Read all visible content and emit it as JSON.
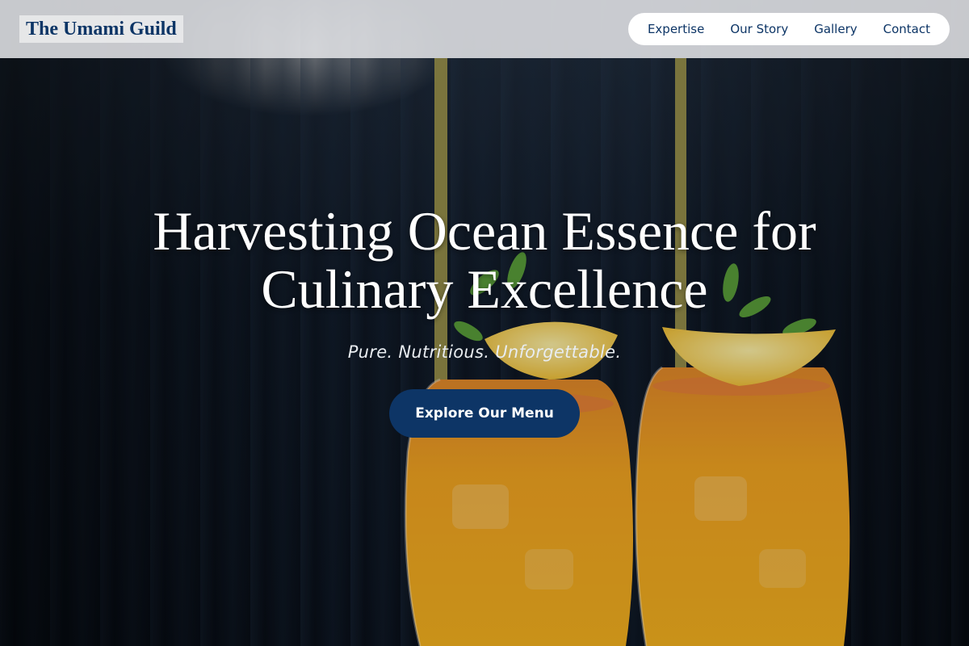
{
  "header": {
    "logo_text": "The Umami Guild",
    "nav": [
      {
        "label": "Expertise"
      },
      {
        "label": "Our Story"
      },
      {
        "label": "Gallery"
      },
      {
        "label": "Contact"
      }
    ]
  },
  "hero": {
    "headline_line1": "Harvesting Ocean Essence for",
    "headline_line2": "Culinary Excellence",
    "tagline": "Pure. Nutritious. Unforgettable.",
    "cta_label": "Explore Our Menu",
    "image_subject": "two orange cocktails with mint and lemon garnish and straws"
  },
  "colors": {
    "brand_navy": "#0d3566",
    "header_bg": "#e1e3e6",
    "drink_orange": "#f0a020"
  }
}
